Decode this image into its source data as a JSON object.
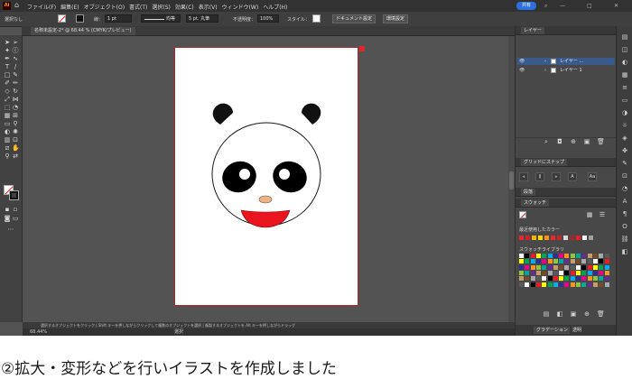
{
  "menubar": {
    "app_logo": "Ai",
    "home_icon": "home-icon",
    "menus": [
      "ファイル(F)",
      "編集(E)",
      "オブジェクト(O)",
      "書式(T)",
      "選択(S)",
      "効果(C)",
      "表示(V)",
      "ウィンドウ(W)",
      "ヘルプ(H)"
    ],
    "share_label": "共有"
  },
  "control_bar": {
    "selection_status": "選択なし",
    "stroke_label": "線：",
    "stroke_weight": "1 pt",
    "stroke_profile": "均等",
    "brush": "5 pt. 丸筆",
    "opacity_label": "不透明度：",
    "opacity_value": "100%",
    "style_label": "スタイル：",
    "document_setup_button": "ドキュメント設定",
    "preferences_button": "環境設定"
  },
  "document_tab": {
    "title": "名称未設定-2* @ 68.44 % (CMYK/プレビュー)"
  },
  "layers_panel": {
    "title": "レイヤー",
    "layers": [
      {
        "name": "レイヤー ...",
        "selected": true
      },
      {
        "name": "レイヤー 1",
        "selected": false
      }
    ]
  },
  "align_panel": {
    "title": "グリッドにスナップ"
  },
  "paragraph_panel": {
    "title": "段落"
  },
  "swatches_panel": {
    "title": "スウォッチ",
    "recent_label": "最近使用したカラー",
    "library_label": "スウォッチライブラリ",
    "recent_colors": [
      "#e8262b",
      "#d91f26",
      "#f4b400",
      "#ffd400",
      "#f7931e",
      "#e8262b",
      "#c1272d",
      "#d8d8d8",
      "#9b2a2a",
      "#ed1c24",
      "#f7f7f7",
      "#a0a0a0",
      "#ff6a00",
      "#c8102e",
      "#ffcc00",
      "#e62e2e"
    ]
  },
  "bottom_tabs": {
    "gradient": "グラデーション",
    "transparency": "透明"
  },
  "status_bar": {
    "hint": "選択するオブジェクトをクリック | Shift キーを押しながらクリックして複数のオブジェクトを選択 | 複製するオブジェクトを Alt キーを押しながらドラッグ",
    "zoom": "68.44%",
    "mode": "選択"
  },
  "colors": {
    "face_fill": "#ffffff",
    "ears": "#111111",
    "eye_patches": "#000000",
    "nose": "#e8b48a",
    "mouth": "#e8141e",
    "artboard_outline": "#b3262e"
  },
  "caption": "②拡大・変形などを行いイラストを作成しました"
}
